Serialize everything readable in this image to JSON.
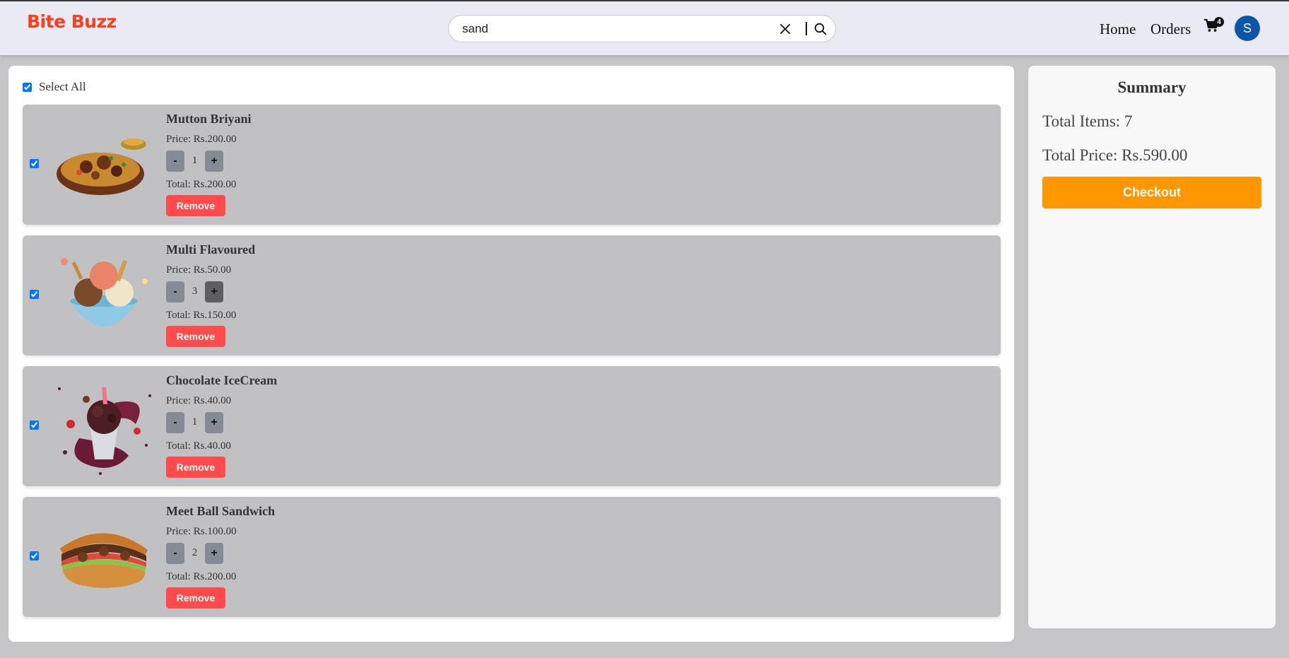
{
  "brand": {
    "name": "Bite Buzz",
    "color": "#ff3d1a"
  },
  "search": {
    "value": "sand",
    "clear_icon": "close-icon",
    "search_icon": "search-icon"
  },
  "nav": {
    "home_label": "Home",
    "orders_label": "Orders",
    "cart_icon": "cart-icon",
    "cart_count": "4",
    "avatar_initial": "S",
    "avatar_color": "#0b56a8"
  },
  "cart": {
    "select_all_label": "Select All",
    "select_all_checked": true,
    "items": [
      {
        "name": "Mutton Briyani",
        "price": "Price: Rs.200.00",
        "quantity": "1",
        "total": "Total: Rs.200.00",
        "checked": true,
        "image": "mutton-briyani-image"
      },
      {
        "name": "Multi Flavoured",
        "price": "Price: Rs.50.00",
        "quantity": "3",
        "total": "Total: Rs.150.00",
        "checked": true,
        "image": "ice-cream-bowl-image"
      },
      {
        "name": "Chocolate IceCream",
        "price": "Price: Rs.40.00",
        "quantity": "1",
        "total": "Total: Rs.40.00",
        "checked": true,
        "image": "chocolate-icecream-image"
      },
      {
        "name": "Meet Ball Sandwich",
        "price": "Price: Rs.100.00",
        "quantity": "2",
        "total": "Total: Rs.200.00",
        "checked": true,
        "image": "sandwich-image"
      }
    ],
    "minus_label": "-",
    "plus_label": "+",
    "remove_label": "Remove"
  },
  "summary": {
    "title": "Summary",
    "total_items": "Total Items: 7",
    "total_price": "Total Price: Rs.590.00",
    "checkout_label": "Checkout",
    "checkout_color": "#ff9800"
  },
  "colors": {
    "remove": "#ff4b4b",
    "item_bg": "#c1c1c3",
    "qty_button": "#858b94"
  }
}
